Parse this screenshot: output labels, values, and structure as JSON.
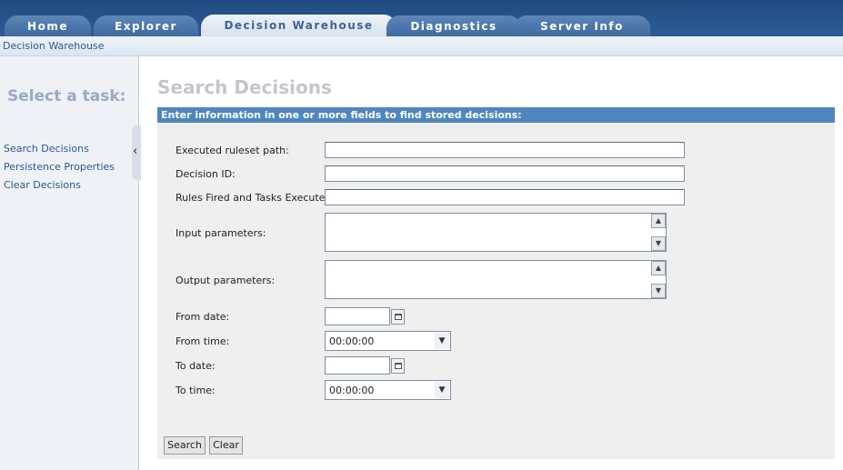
{
  "tabs": [
    {
      "label": "Home"
    },
    {
      "label": "Explorer"
    },
    {
      "label": "Decision Warehouse"
    },
    {
      "label": "Diagnostics"
    },
    {
      "label": "Server Info"
    }
  ],
  "breadcrumb": "Decision Warehouse",
  "sidebar": {
    "title": "Select a task:",
    "collapse_glyph": "‹",
    "links": [
      "Search Decisions",
      "Persistence Properties",
      "Clear Decisions"
    ]
  },
  "main": {
    "title": "Search Decisions",
    "panel_header": "Enter information in one or more fields to find stored decisions:",
    "fields": {
      "ruleset_path": {
        "label": "Executed ruleset path:",
        "value": ""
      },
      "decision_id": {
        "label": "Decision ID:",
        "value": ""
      },
      "rules_fired": {
        "label": "Rules Fired and Tasks Executed:",
        "value": ""
      },
      "input_params": {
        "label": "Input parameters:",
        "value": ""
      },
      "output_params": {
        "label": "Output parameters:",
        "value": ""
      },
      "from_date": {
        "label": "From date:",
        "value": ""
      },
      "from_time": {
        "label": "From time:",
        "value": "00:00:00"
      },
      "to_date": {
        "label": "To date:",
        "value": ""
      },
      "to_time": {
        "label": "To time:",
        "value": "00:00:00"
      }
    },
    "buttons": {
      "search": "Search",
      "clear": "Clear"
    }
  },
  "colors": {
    "tab_bar": "#1e4a80",
    "panel_header": "#4f86c0",
    "link": "#2a5a96"
  }
}
